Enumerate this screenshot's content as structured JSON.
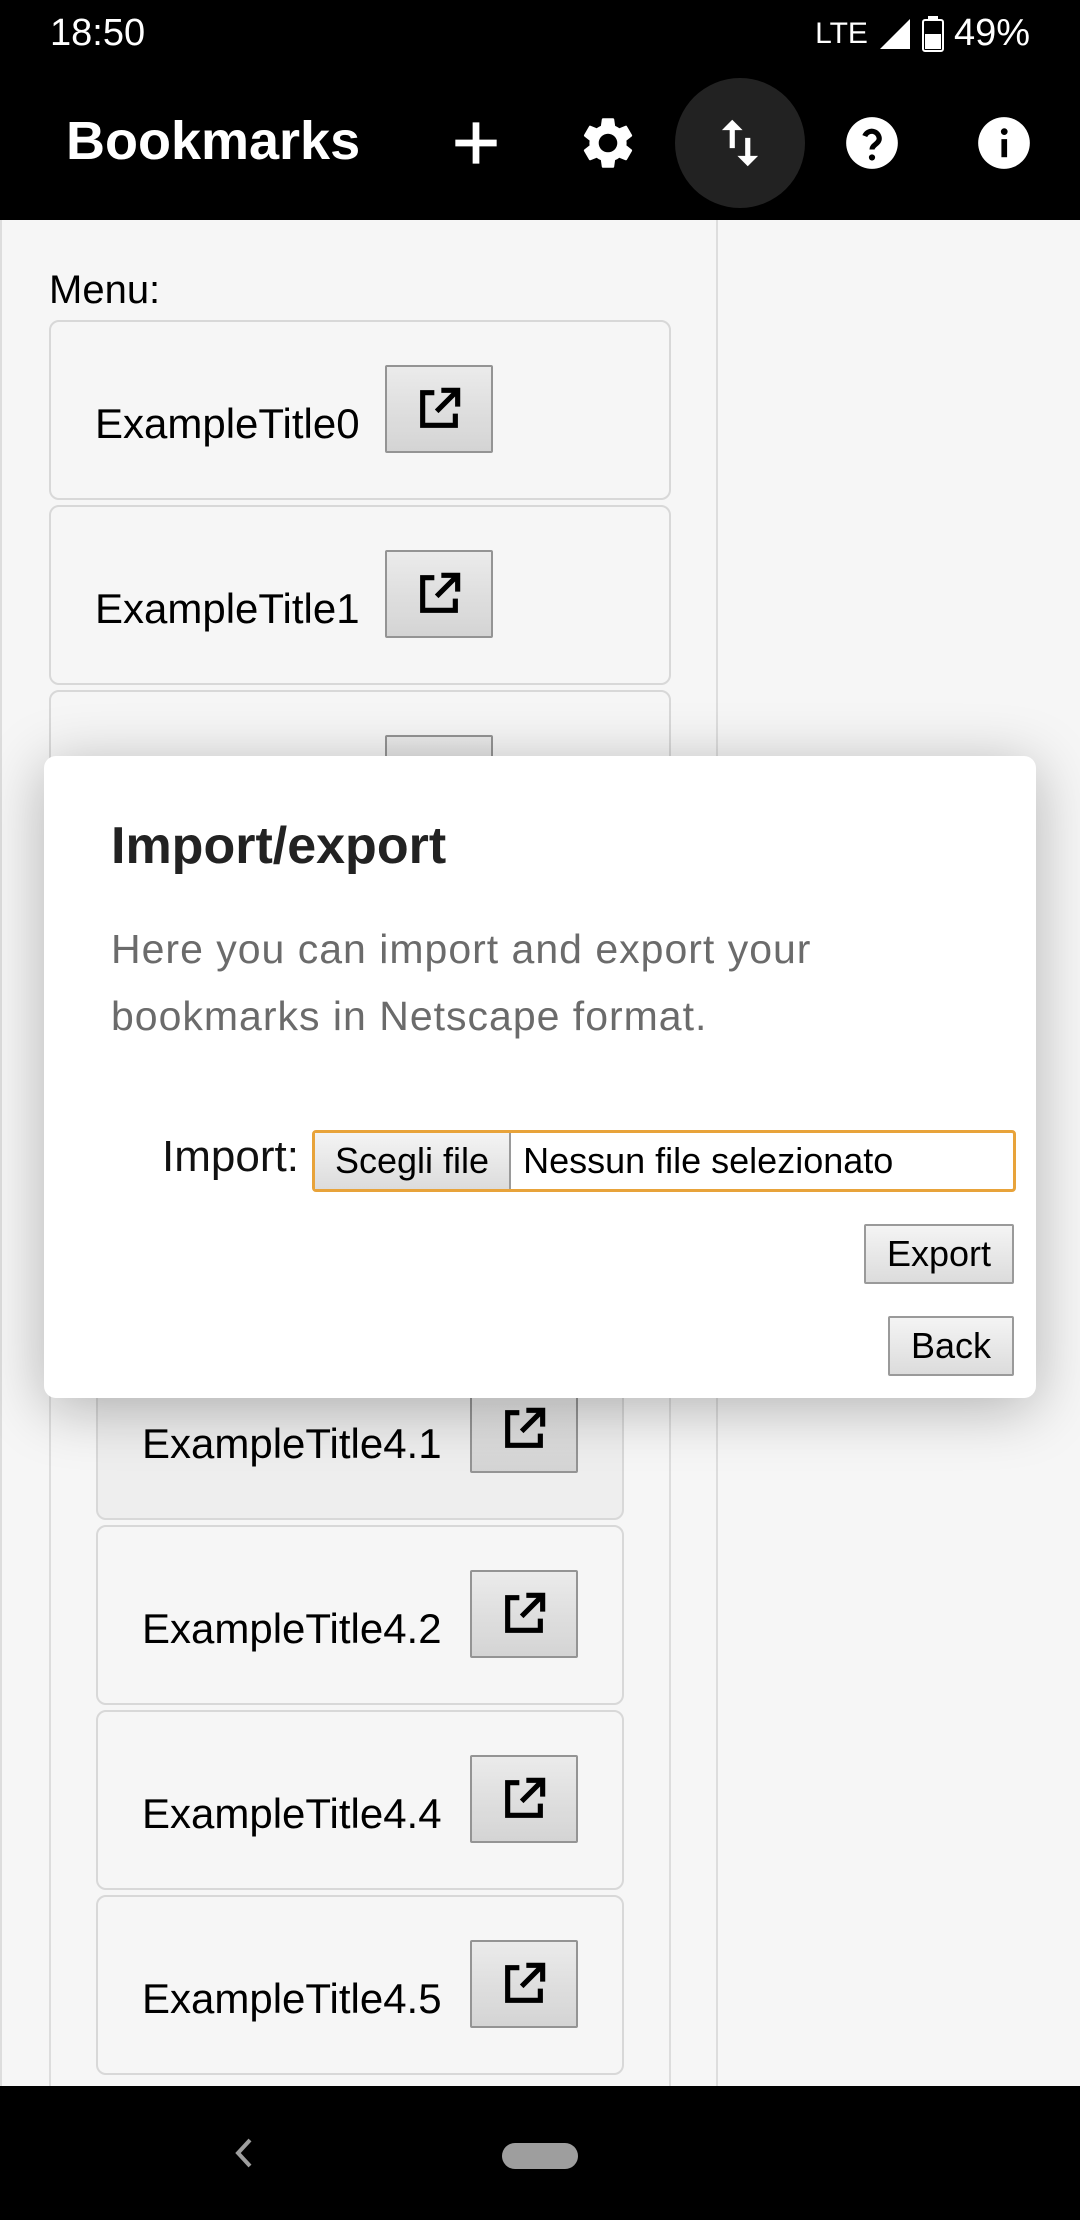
{
  "status_bar": {
    "time": "18:50",
    "network": "LTE",
    "battery": "49%"
  },
  "app_bar": {
    "title": "Bookmarks",
    "actions": [
      "add-icon",
      "settings-gear-icon",
      "import-export-arrows-icon",
      "help-icon",
      "info-icon"
    ]
  },
  "menu": {
    "label": "Menu:",
    "items": [
      {
        "title": "ExampleTitle0"
      },
      {
        "title": "ExampleTitle1"
      }
    ],
    "sub_items": [
      {
        "title": "ExampleTitle4.1"
      },
      {
        "title": "ExampleTitle4.2"
      },
      {
        "title": "ExampleTitle4.4"
      },
      {
        "title": "ExampleTitle4.5"
      }
    ]
  },
  "dialog": {
    "title": "Import/export",
    "description": "Here you can import and export your bookmarks in Netscape format.",
    "import_label": "Import:",
    "file_button": "Scegli file",
    "file_status": "Nessun file selezionato",
    "export_button": "Export",
    "back_button": "Back"
  },
  "colors": {
    "bar_bg": "#000000",
    "focus_ring": "#e8a33a"
  }
}
